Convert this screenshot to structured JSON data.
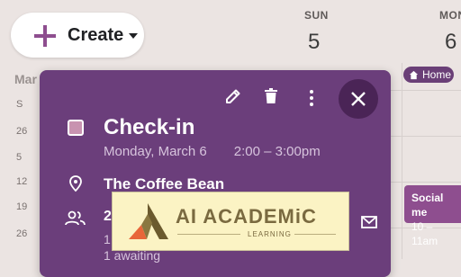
{
  "create_button": {
    "label": "Create"
  },
  "mini_calendar": {
    "month": "Mar",
    "rows": [
      "S",
      "26",
      "5",
      "12",
      "19",
      "26"
    ]
  },
  "days": [
    {
      "name": "SUN",
      "number": "5"
    },
    {
      "name": "MON",
      "number": "6"
    }
  ],
  "all_day_chip": {
    "label": "Home"
  },
  "side_event": {
    "title": "Social me",
    "time": "10 – 11am"
  },
  "event": {
    "title": "Check-in",
    "date": "Monday, March 6",
    "time": "2:00 – 3:00pm",
    "location": "The Coffee Bean",
    "guests_count": "2",
    "guests_line1": "1",
    "guests_line2": "1 awaiting"
  },
  "watermark": {
    "word": "AI ACADEMiC",
    "sub": "LEARNING"
  },
  "colors": {
    "event_purple": "#6b3e7b",
    "close_bg": "#4a2456",
    "accent_plus": "#8e4e8f"
  }
}
